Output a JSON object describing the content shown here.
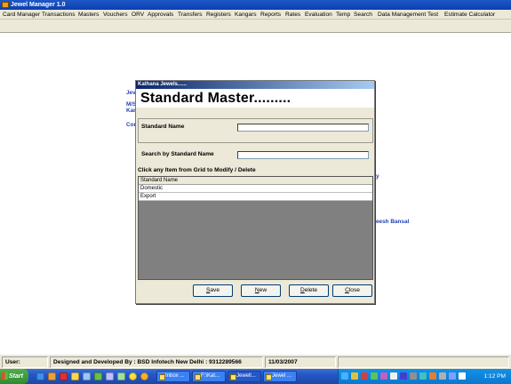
{
  "window": {
    "title": "Jewel Manager 1.0"
  },
  "menu": [
    "Card Manager",
    "Transactions",
    "Masters",
    "Vouchers",
    "ORV",
    "Approvals",
    "Transfers",
    "Registers",
    "Kangars",
    "Reports",
    "Rates",
    "Evaluation",
    "Temp",
    "Search",
    "Data Management",
    "Test",
    "Estimate Calculator"
  ],
  "background_text": {
    "line1": "Jev",
    "line2": "M/S",
    "line3": "Kar",
    "line4": "Cor",
    "line5": "y",
    "line6": "eesh Bansal"
  },
  "dialog": {
    "title": "Kathana Jewels......",
    "heading": "Standard Master.........",
    "standard_name_label": "Standard Name",
    "standard_name_value": "",
    "search_label": "Search by Standard Name",
    "search_value": "",
    "grid_instruction": "Click any Item from Grid to Modify / Delete",
    "grid_header": "Standard Name",
    "grid_rows": [
      "Domestic",
      "Export"
    ],
    "buttons": {
      "save": {
        "underline": "S",
        "rest": "ave"
      },
      "new": {
        "underline": "N",
        "rest": "ew"
      },
      "delete": {
        "underline": "D",
        "rest": "elete"
      },
      "close": {
        "underline": "C",
        "rest": "lose"
      }
    }
  },
  "statusbar": {
    "user": "User:",
    "credits": "Designed and Developed By : BSD Infotech New Delhi : 9312289566",
    "date": "11/03/2007"
  },
  "taskbar": {
    "start": "Start",
    "tasks": [
      "Inbox ...",
      "F:\\Kat...",
      "Jewell...",
      "Jewel ..."
    ],
    "clock": "1:12 PM",
    "quicklaunch_icons": [
      "ie-icon",
      "media-icon",
      "messenger-icon",
      "mail-icon",
      "folder-icon",
      "search-icon",
      "music-icon",
      "paint-icon",
      "smiley-icon"
    ],
    "tray_icons": [
      "network-icon",
      "shield-icon",
      "antivirus-icon",
      "msn-icon",
      "update-icon",
      "volume-icon",
      "bluetooth-icon",
      "printer-icon",
      "sync-icon",
      "security-icon"
    ]
  }
}
